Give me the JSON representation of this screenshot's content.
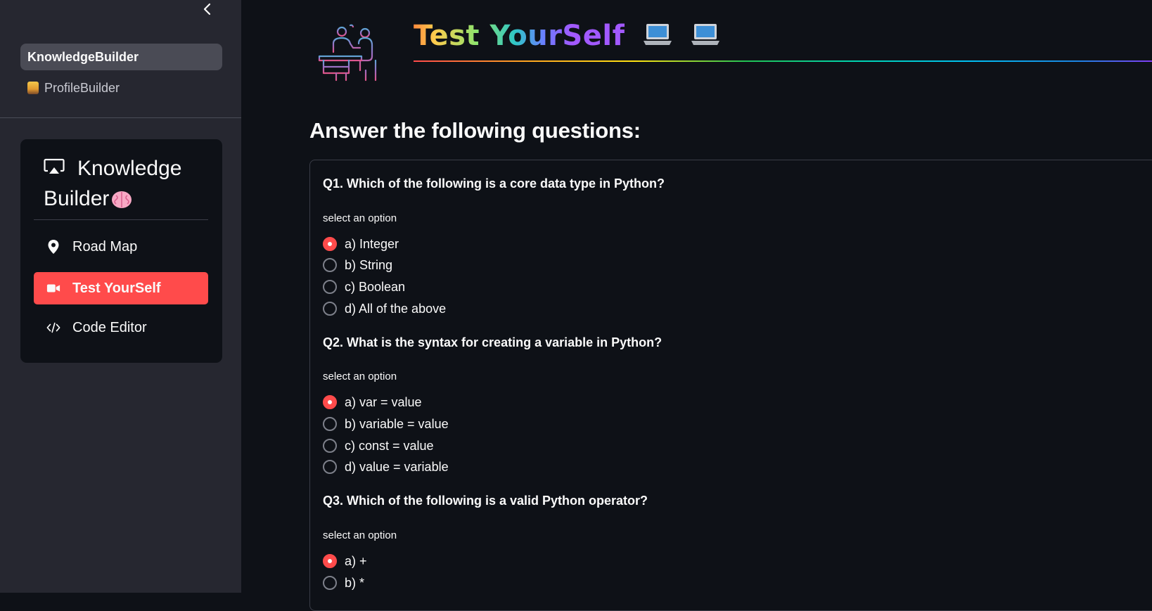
{
  "sidebar": {
    "pages": [
      {
        "label": "KnowledgeBuilder",
        "active": true
      },
      {
        "label": "ProfileBuilder",
        "active": false,
        "icon": "person-emoji-icon"
      }
    ],
    "menu": {
      "title_line1": "Knowledge",
      "title_line2": "Builder",
      "title_icon": "airplay-icon",
      "items": [
        {
          "label": "Road Map",
          "icon": "map-pin-icon",
          "selected": false
        },
        {
          "label": "Test YourSelf",
          "icon": "video-camera-icon",
          "selected": true
        },
        {
          "label": "Code Editor",
          "icon": "code-icon",
          "selected": false
        }
      ]
    }
  },
  "main": {
    "title": "Test YourSelf",
    "heading": "Answer the following questions:",
    "questions": [
      {
        "question": "Q1. Which of the following is a core data type in Python?",
        "select_label": "select an option",
        "options": [
          "a) Integer",
          "b) String",
          "c) Boolean",
          "d) All of the above"
        ],
        "selected": 0
      },
      {
        "question": "Q2. What is the syntax for creating a variable in Python?",
        "select_label": "select an option",
        "options": [
          "a) var = value",
          "b) variable = value",
          "c) const = value",
          "d) value = variable"
        ],
        "selected": 0
      },
      {
        "question": "Q3. Which of the following is a valid Python operator?",
        "select_label": "select an option",
        "options": [
          "a) +",
          "b) *"
        ],
        "selected": 0
      }
    ]
  },
  "colors": {
    "background": "#0e1117",
    "sidebar": "#262730",
    "accent": "#ff4b4b"
  }
}
